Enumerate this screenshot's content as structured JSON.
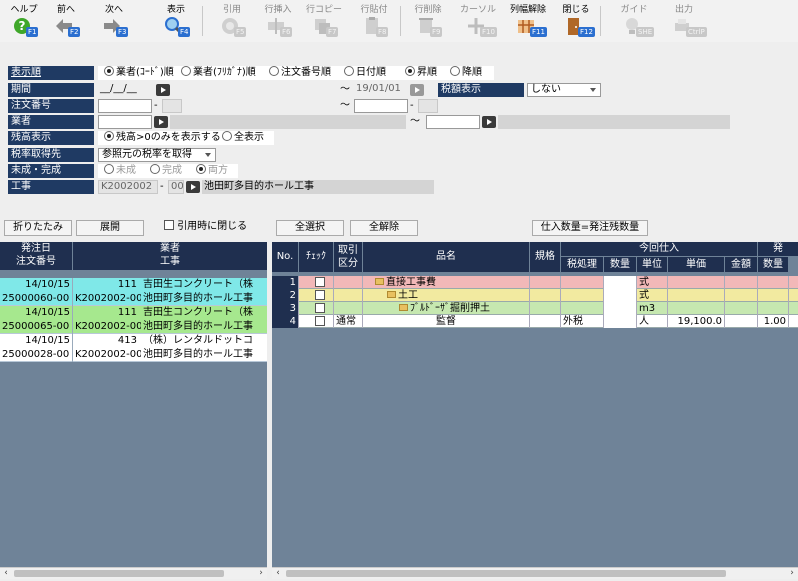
{
  "toolbar": {
    "buttons": [
      {
        "label": "ヘルプ",
        "key": "F1",
        "icon": "help-icon"
      },
      {
        "label": "前へ",
        "key": "F2",
        "icon": "arrow-left-icon"
      },
      {
        "label": "次へ",
        "key": "F3",
        "icon": "arrow-right-icon"
      },
      {
        "label": "表示",
        "key": "F4",
        "icon": "magnifier-icon"
      },
      {
        "label": "引用",
        "key": "F5",
        "icon": "quote-icon"
      },
      {
        "label": "行挿入",
        "key": "F6",
        "icon": "row-insert-icon"
      },
      {
        "label": "行コピー",
        "key": "F7",
        "icon": "row-copy-icon"
      },
      {
        "label": "行貼付",
        "key": "F8",
        "icon": "row-paste-icon"
      },
      {
        "label": "行削除",
        "key": "F9",
        "icon": "row-delete-icon"
      },
      {
        "label": "カーソル",
        "key": "F10",
        "icon": "cursor-icon"
      },
      {
        "label": "列幅解除",
        "key": "F11",
        "icon": "column-width-icon"
      },
      {
        "label": "閉じる",
        "key": "F12",
        "icon": "close-door-icon"
      },
      {
        "label": "ガイド",
        "key": "SHE",
        "icon": "bulb-icon"
      },
      {
        "label": "出力",
        "key": "CtrlP",
        "icon": "print-icon"
      }
    ]
  },
  "form": {
    "labels": {
      "sort": "表示順",
      "period": "期間",
      "order_no": "注文番号",
      "vendor": "業者",
      "balance": "残高表示",
      "tax_from": "税率取得先",
      "status": "未成・完成",
      "project": "工事",
      "tax_display": "税額表示"
    },
    "sort_options": [
      "業者(ｺｰﾄﾞ)順",
      "業者(ﾌﾘｶﾞﾅ)順",
      "注文番号順",
      "日付順"
    ],
    "order_options": [
      "昇順",
      "降順"
    ],
    "period_from": "__/__/__",
    "period_to": "19/01/01",
    "tilde": "～",
    "dash": "-",
    "tax_display_value": "しない",
    "balance_options": [
      "残高>0のみを表示する",
      "全表示"
    ],
    "tax_from_value": "参照元の税率を取得",
    "status_options": [
      "未成",
      "完成",
      "両方"
    ],
    "project_code": "K2002002",
    "project_sub": "00",
    "project_name": "池田町多目的ホール工事"
  },
  "actions": {
    "collapse": "折りたたみ",
    "expand": "展開",
    "close_on_quote": "引用時に閉じる",
    "select_all": "全選択",
    "deselect_all": "全解除",
    "qty_set": "仕入数量=発注残数量"
  },
  "left_grid": {
    "headers": {
      "date": "発注日",
      "vendor": "業者",
      "order": "注文番号",
      "project": "工事"
    },
    "rows": [
      {
        "date": "14/10/15",
        "code": "111",
        "vendor": "吉田生コンクリート（株",
        "order": "25000060-00",
        "pcode": "K2002002-00",
        "project": "池田町多目的ホール工事",
        "color": "#7fe8e8"
      },
      {
        "date": "14/10/15",
        "code": "111",
        "vendor": "吉田生コンクリート（株",
        "order": "25000065-00",
        "pcode": "K2002002-00",
        "project": "池田町多目的ホール工事",
        "color": "#a6e88e"
      },
      {
        "date": "14/10/15",
        "code": "413",
        "vendor": "（株）レンタルドットコ",
        "order": "25000028-00",
        "pcode": "K2002002-00",
        "project": "池田町多目的ホール工事",
        "color": "#ffffff"
      }
    ]
  },
  "right_grid": {
    "headers": {
      "no": "No.",
      "check": "ﾁｪｯｸ",
      "type": "取引区分",
      "item": "品名",
      "spec": "規格",
      "current": "今回仕入",
      "tax": "税処理",
      "qty": "数量",
      "unit": "単位",
      "price": "単価",
      "amount": "金額",
      "order_group": "発",
      "qty2": "数量"
    },
    "rows": [
      {
        "no": "1",
        "type": "",
        "item": "直接工事費",
        "indent": 1,
        "tax": "",
        "qty": "",
        "unit": "式",
        "price": "",
        "amount": "",
        "qty2": "",
        "color": "#f2b8b8"
      },
      {
        "no": "2",
        "type": "",
        "item": "土工",
        "indent": 2,
        "tax": "",
        "qty": "",
        "unit": "式",
        "price": "",
        "amount": "",
        "qty2": "",
        "color": "#f2eaa0"
      },
      {
        "no": "3",
        "type": "",
        "item": "ﾌﾞﾙﾄﾞｰｻﾞ掘削押土",
        "indent": 3,
        "tax": "",
        "qty": "",
        "unit": "m3",
        "price": "",
        "amount": "",
        "qty2": "",
        "color": "#c6e8b0"
      },
      {
        "no": "4",
        "type": "通常",
        "item": "監督",
        "indent": 0,
        "tax": "外税",
        "qty": "",
        "unit": "人",
        "price": "19,100.0",
        "amount": "",
        "qty2": "1.00",
        "color": "#ffffff"
      }
    ]
  },
  "colors": {
    "label_bg": "#1f3a63",
    "grid_header": "#1f2f4f",
    "grid_body": "#6f8398",
    "accent_key": "#2b6fd0"
  }
}
